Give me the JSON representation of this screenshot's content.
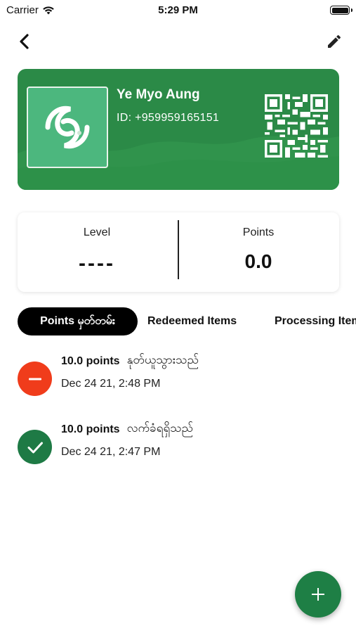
{
  "status_bar": {
    "carrier": "Carrier",
    "time": "5:29 PM",
    "wifi_icon": "wifi-icon",
    "battery_icon": "battery-icon"
  },
  "nav": {
    "back_icon": "chevron-left-icon",
    "edit_icon": "pencil-icon"
  },
  "member_card": {
    "name": "Ye Myo Aung",
    "id": "ID: +959959165151",
    "logo_icon": "swirl-logo-icon",
    "qr_icon": "qr-code-icon",
    "background_color": "#2b8a47"
  },
  "stats": {
    "level_label": "Level",
    "level_value": "----",
    "points_label": "Points",
    "points_value": "0.0"
  },
  "tabs": [
    {
      "label": "Points မှတ်တမ်း",
      "active": true
    },
    {
      "label": "Redeemed Items",
      "active": false
    },
    {
      "label": "Processing Items",
      "active": false
    }
  ],
  "history": [
    {
      "points": "10.0 points",
      "description": "နုတ်ယူသွားသည်",
      "time": "Dec 24 21, 2:48 PM",
      "icon": "minus-circle-icon",
      "color": "#f03c1b"
    },
    {
      "points": "10.0 points",
      "description": "လက်ခံရရှိသည်",
      "time": "Dec 24 21, 2:47 PM",
      "icon": "check-circle-icon",
      "color": "#1e7a45"
    }
  ],
  "fab": {
    "icon": "plus-icon",
    "color": "#1e7f45"
  }
}
